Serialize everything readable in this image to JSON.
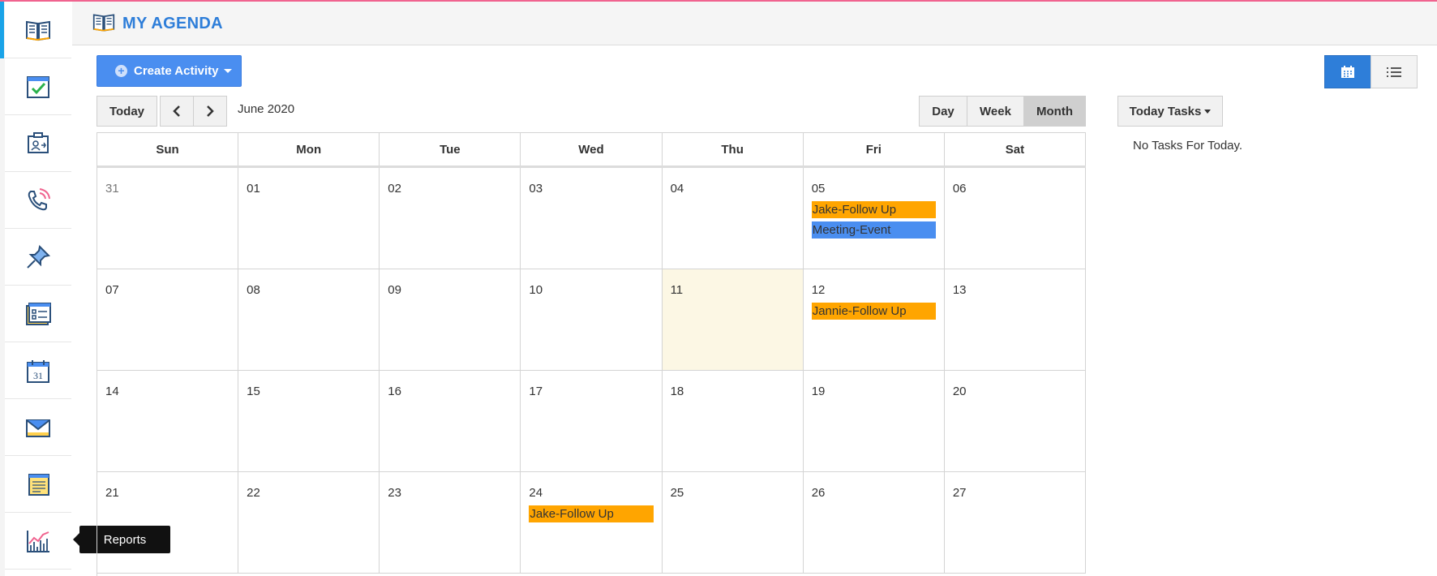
{
  "header": {
    "title": "MY AGENDA"
  },
  "sidebar": {
    "items": [
      {
        "name": "agenda",
        "icon": "book-icon"
      },
      {
        "name": "tasks",
        "icon": "task-check-icon"
      },
      {
        "name": "contacts",
        "icon": "contact-card-icon"
      },
      {
        "name": "calls",
        "icon": "phone-icon"
      },
      {
        "name": "pins",
        "icon": "pushpin-icon"
      },
      {
        "name": "forms",
        "icon": "form-list-icon"
      },
      {
        "name": "calendar",
        "icon": "calendar-31-icon"
      },
      {
        "name": "email",
        "icon": "envelope-icon"
      },
      {
        "name": "notes",
        "icon": "note-icon"
      },
      {
        "name": "reports",
        "icon": "chart-icon"
      }
    ],
    "tooltip": "Reports"
  },
  "toolbar": {
    "create_label": "Create Activity",
    "today_label": "Today",
    "month_label": "June 2020",
    "views": {
      "day": "Day",
      "week": "Week",
      "month": "Month"
    },
    "active_view": "Month"
  },
  "tasks": {
    "button_label": "Today Tasks",
    "empty_text": "No Tasks For Today."
  },
  "calendar": {
    "weekdays": [
      "Sun",
      "Mon",
      "Tue",
      "Wed",
      "Thu",
      "Fri",
      "Sat"
    ],
    "today": "11",
    "weeks": [
      [
        {
          "day": "31",
          "other": true,
          "events": []
        },
        {
          "day": "01",
          "events": []
        },
        {
          "day": "02",
          "events": []
        },
        {
          "day": "03",
          "events": []
        },
        {
          "day": "04",
          "events": []
        },
        {
          "day": "05",
          "events": [
            {
              "title": "Jake-Follow Up",
              "color": "#ffa500"
            },
            {
              "title": "Meeting-Event",
              "color": "#4a8ef0"
            }
          ]
        },
        {
          "day": "06",
          "events": []
        }
      ],
      [
        {
          "day": "07",
          "events": []
        },
        {
          "day": "08",
          "events": []
        },
        {
          "day": "09",
          "events": []
        },
        {
          "day": "10",
          "events": []
        },
        {
          "day": "11",
          "events": []
        },
        {
          "day": "12",
          "events": [
            {
              "title": "Jannie-Follow Up",
              "color": "#ffa500"
            }
          ]
        },
        {
          "day": "13",
          "events": []
        }
      ],
      [
        {
          "day": "14",
          "events": []
        },
        {
          "day": "15",
          "events": []
        },
        {
          "day": "16",
          "events": []
        },
        {
          "day": "17",
          "events": []
        },
        {
          "day": "18",
          "events": []
        },
        {
          "day": "19",
          "events": []
        },
        {
          "day": "20",
          "events": []
        }
      ],
      [
        {
          "day": "21",
          "events": []
        },
        {
          "day": "22",
          "events": []
        },
        {
          "day": "23",
          "events": []
        },
        {
          "day": "24",
          "events": [
            {
              "title": "Jake-Follow Up",
              "color": "#ffa500"
            }
          ]
        },
        {
          "day": "25",
          "events": []
        },
        {
          "day": "26",
          "events": []
        },
        {
          "day": "27",
          "events": []
        }
      ]
    ]
  },
  "colors": {
    "accent": "#2e7ed9",
    "create_button": "#4a8ef0",
    "today_cell": "#fcf7e4",
    "top_line": "#f0638f"
  }
}
